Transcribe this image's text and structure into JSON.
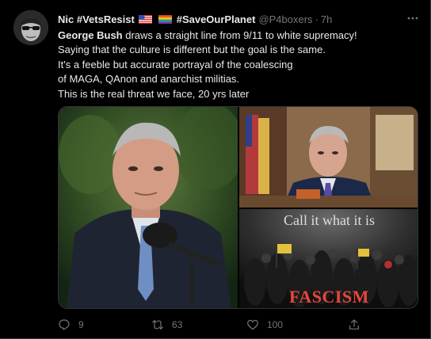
{
  "tweet": {
    "author": {
      "display_name_prefix": "Nic #VetsResist",
      "display_name_suffix": "#SaveOurPlanet",
      "handle": "@P4boxers",
      "separator": "·",
      "time": "7h"
    },
    "body": {
      "line1_bold": "George Bush",
      "line1_rest": " draws a straight line from 9/11 to white supremacy!",
      "line2": "Saying that the culture is different but the goal is the same.",
      "line3": "It's a feeble but accurate portrayal of the coalescing",
      "line4": "of MAGA, QAnon and anarchist militias.",
      "line5": "This is the real threat we face, 20 yrs later"
    },
    "media": {
      "caption_top": "Call it what it is",
      "caption_bottom": "FASCISM"
    },
    "actions": {
      "reply_count": "9",
      "retweet_count": "63",
      "like_count": "100"
    }
  }
}
